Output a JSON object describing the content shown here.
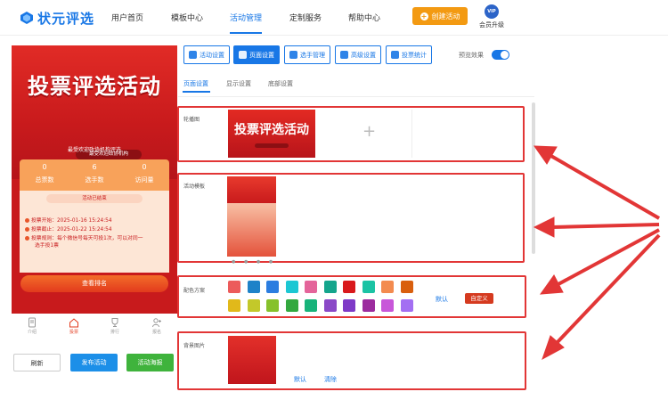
{
  "brand": {
    "name": "状元评选",
    "color": "#1877e6"
  },
  "nav": {
    "items": [
      {
        "label": "用户首页",
        "active": false
      },
      {
        "label": "模板中心",
        "active": false
      },
      {
        "label": "活动管理",
        "active": true
      },
      {
        "label": "定制服务",
        "active": false
      },
      {
        "label": "帮助中心",
        "active": false
      }
    ],
    "create_label": "创建活动",
    "vip_badge": "VIP",
    "vip_label": "会员升级"
  },
  "phone": {
    "hero_title": "投票评选活动",
    "hero_pill": "最受欢迎政协机构",
    "org_line": "最受欢迎政协机构评选",
    "stats": [
      {
        "value": "0",
        "label": "总票数"
      },
      {
        "value": "6",
        "label": "选手数"
      },
      {
        "value": "0",
        "label": "访问量"
      }
    ],
    "ended_label": "活动已结束",
    "info": [
      "投票开始：2025-01-16 15:24:54",
      "投票截止：2025-01-22 15:24:54",
      "投票规则：每个微信号每天可投1次，可以对同一",
      "选手投1票"
    ],
    "rank_button": "查看排名",
    "tabs": [
      {
        "label": "介绍",
        "icon": "document-icon",
        "active": false
      },
      {
        "label": "投票",
        "icon": "home-icon",
        "active": true
      },
      {
        "label": "排行",
        "icon": "trophy-icon",
        "active": false
      },
      {
        "label": "报名",
        "icon": "person-add-icon",
        "active": false
      }
    ]
  },
  "actions": {
    "refresh": "刷新",
    "publish": "发布活动",
    "poster": "活动海报"
  },
  "toolbar": {
    "items": [
      {
        "label": "活动设置",
        "icon": "settings-icon",
        "active": false
      },
      {
        "label": "页面设置",
        "icon": "gear-icon",
        "active": true
      },
      {
        "label": "选手管理",
        "icon": "users-icon",
        "active": false
      },
      {
        "label": "高级设置",
        "icon": "sliders-icon",
        "active": false
      },
      {
        "label": "投票统计",
        "icon": "bar-chart-icon",
        "active": false
      }
    ],
    "preview_label": "预览效果",
    "preview_on": true
  },
  "subtabs": [
    {
      "label": "页面设置",
      "active": true
    },
    {
      "label": "显示设置",
      "active": false
    },
    {
      "label": "底部设置",
      "active": false
    }
  ],
  "sections": {
    "banner_label": "轮播图",
    "banner_text": "投票评选活动",
    "template_label": "活动模板",
    "color_label": "配色方案",
    "color_default": "默认",
    "color_custom": "自定义",
    "bg_label": "背景图片",
    "bg_default": "默认",
    "bg_clear": "清除"
  },
  "palette": [
    "#ec5b5b",
    "#1e82c8",
    "#2b7de0",
    "#1cc7d3",
    "#e4649a",
    "#14a58c",
    "#d9191c",
    "#1bc3a4",
    "#f38b4f",
    "#d95f0e",
    "#e1b91a",
    "#c3c82a",
    "#86c12b",
    "#33a83f",
    "#18b37a",
    "#8a49c7",
    "#7e3ac7",
    "#9c2c9e",
    "#c857d9",
    "#a36ff2"
  ],
  "accent_red": "#e23636"
}
